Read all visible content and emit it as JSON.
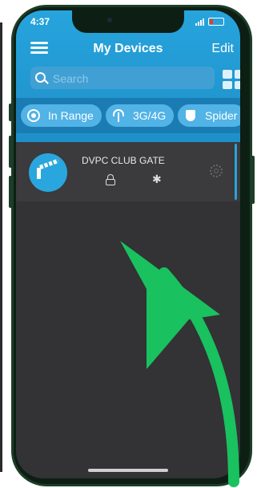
{
  "status_bar": {
    "time": "4:37"
  },
  "header": {
    "title": "My Devices",
    "edit_label": "Edit"
  },
  "search": {
    "placeholder": "Search",
    "value": ""
  },
  "filters": [
    {
      "label": "In Range",
      "icon": "target-icon"
    },
    {
      "label": "3G/4G",
      "icon": "antenna-icon"
    },
    {
      "label": "Spider",
      "icon": "shield-icon"
    }
  ],
  "devices": [
    {
      "name": "DVPC CLUB GATE",
      "icons": [
        "lock-icon",
        "bluetooth-icon"
      ]
    }
  ],
  "colors": {
    "header_blue": "#27a4dd",
    "filter_bar": "#1a7cb3",
    "chip": "#51b3e6",
    "list_background": "#333234",
    "row_background": "#3b3a3c",
    "arrow_green": "#19c15f",
    "phone_frame": "#1c3d27"
  }
}
